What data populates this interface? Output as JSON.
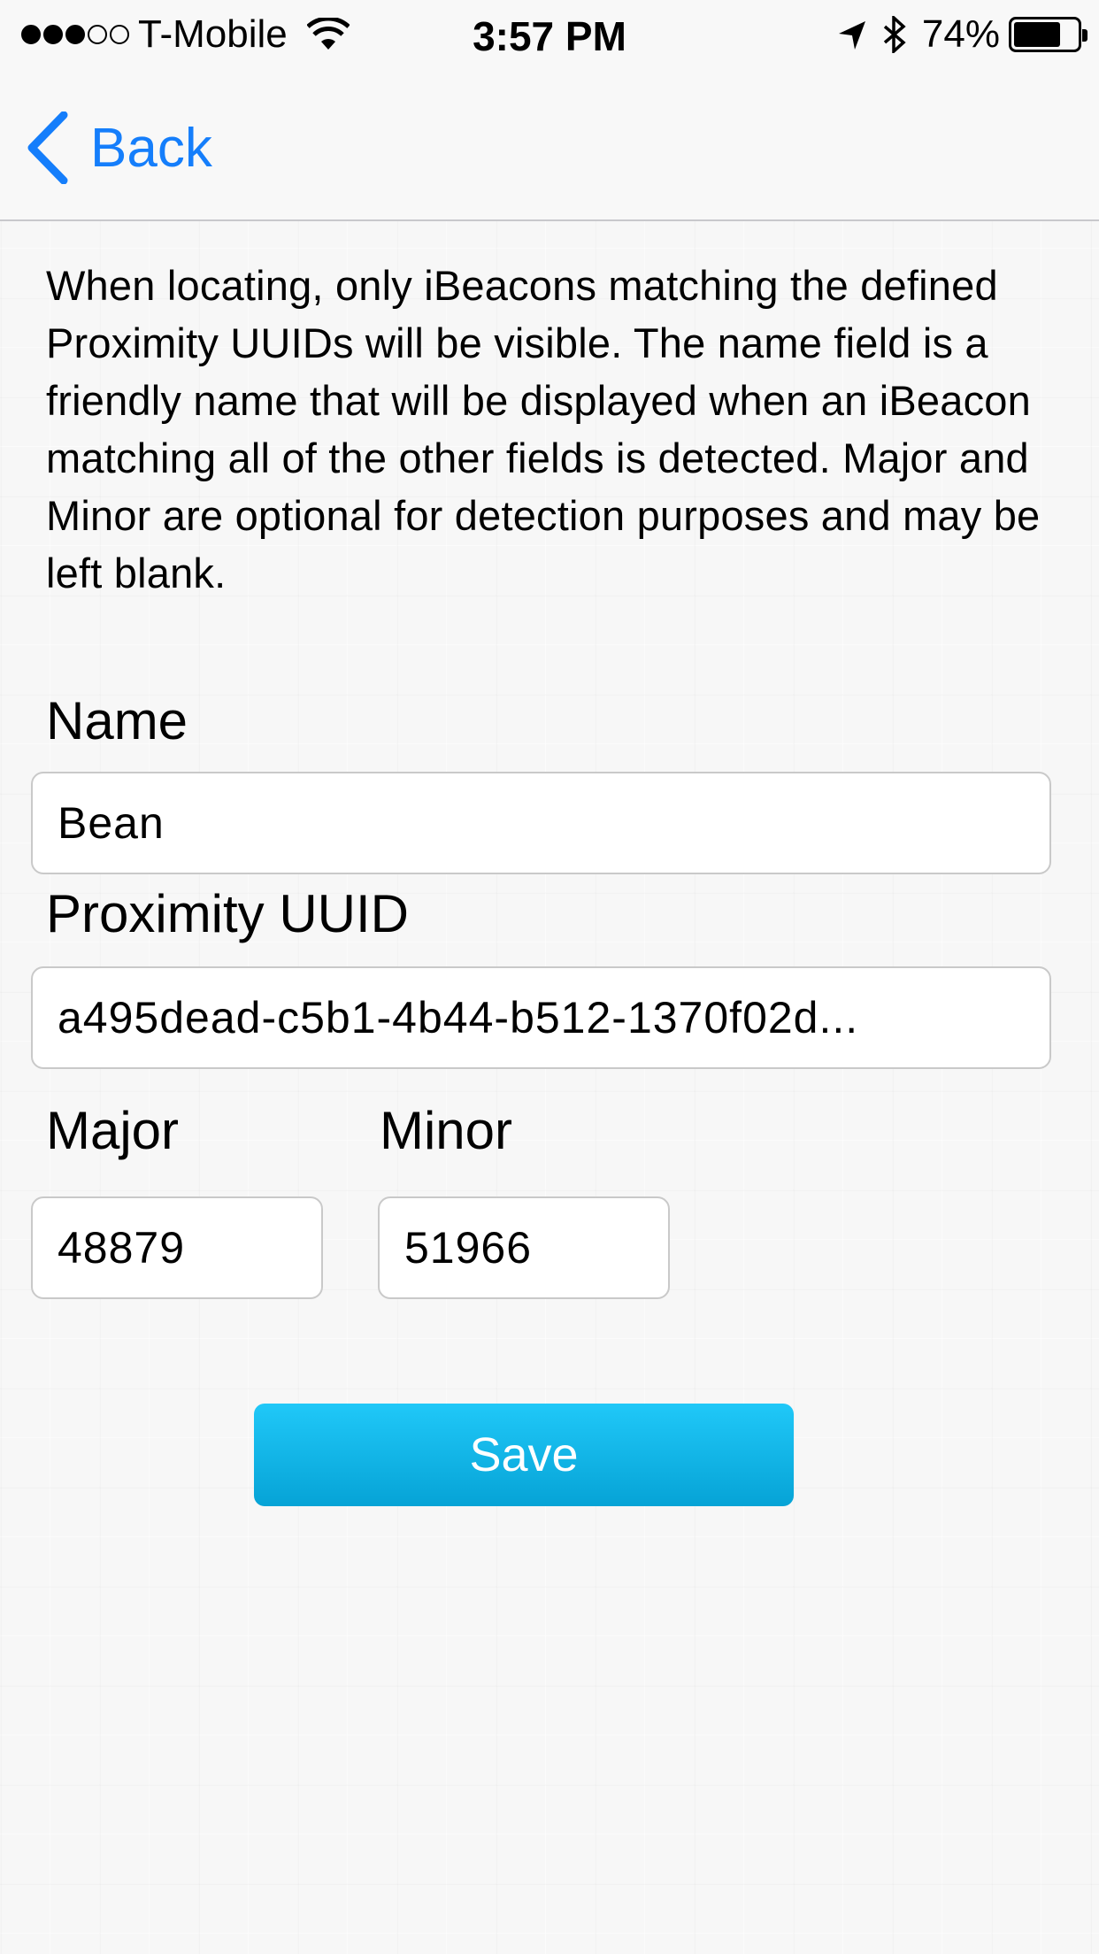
{
  "status_bar": {
    "carrier": "T-Mobile",
    "signal_bars_filled": 3,
    "signal_bars_total": 5,
    "time": "3:57 PM",
    "battery_percent": "74%",
    "battery_level": 0.74,
    "icons": [
      "wifi-icon",
      "location-arrow-icon",
      "bluetooth-icon",
      "battery-icon"
    ]
  },
  "nav": {
    "back_label": "Back",
    "accent_color": "#157efb"
  },
  "description": "When locating, only iBeacons matching the defined Proximity UUIDs will be visible.  The name field is a friendly name that will be displayed when an iBeacon matching all of the other fields is detected.  Major and Minor are optional for detection purposes and may be left blank.",
  "form": {
    "name_label": "Name",
    "name_value": "Bean",
    "uuid_label": "Proximity UUID",
    "uuid_value": "a495dead-c5b1-4b44-b512-1370f02d...",
    "major_label": "Major",
    "major_value": "48879",
    "minor_label": "Minor",
    "minor_value": "51966"
  },
  "save_button": {
    "label": "Save",
    "color": "#12b4e8"
  }
}
